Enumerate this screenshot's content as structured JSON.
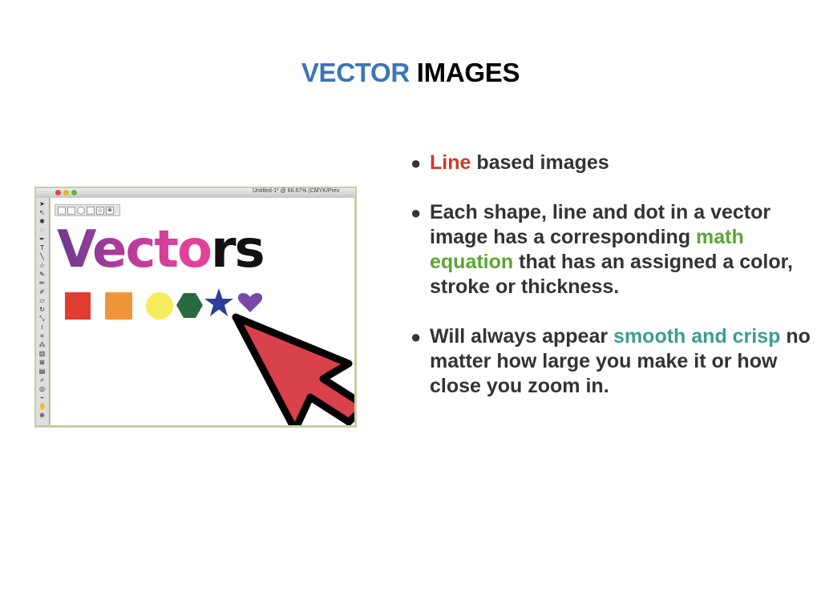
{
  "title": {
    "part1": "VECTOR",
    "part2": " IMAGES"
  },
  "screenshot": {
    "window_title": "Untitled-1* @ 66.67% (CMYK/Prev",
    "canvas_word_main": "Vecto",
    "canvas_word_end": "rs",
    "colors": {
      "square_red": "#e03c31",
      "square_orange": "#f0943a",
      "circle_yellow": "#f5ec5c",
      "hexagon_green": "#2a6b3e",
      "star_blue": "#2b3f9a",
      "heart_purple": "#7a48a6",
      "cursor_red": "#d9414b"
    }
  },
  "bullets": [
    {
      "parts": [
        {
          "text": "Line",
          "style": "red"
        },
        {
          "text": " based images",
          "style": "plain"
        }
      ]
    },
    {
      "parts": [
        {
          "text": "Each shape, line and dot in a vector image has a corresponding ",
          "style": "plain"
        },
        {
          "text": "math equation",
          "style": "green"
        },
        {
          "text": " that has an assigned a color, stroke or thickness.",
          "style": "plain"
        }
      ]
    },
    {
      "parts": [
        {
          "text": "Will always appear ",
          "style": "plain"
        },
        {
          "text": "smooth and crisp",
          "style": "teal"
        },
        {
          "text": " no matter how large you make it or how close you zoom in.",
          "style": "plain"
        }
      ]
    }
  ]
}
